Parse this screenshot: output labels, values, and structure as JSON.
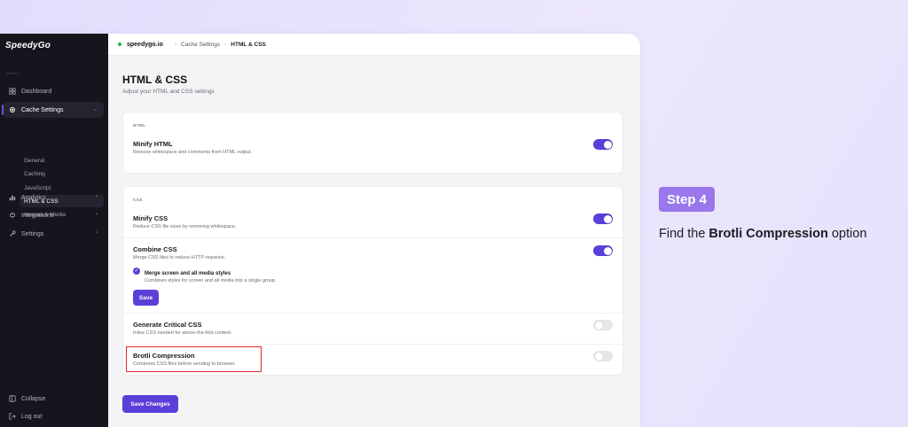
{
  "app": {
    "logo": "SpeedyGo"
  },
  "sidebar": {
    "menu_heading": "MENU",
    "items": [
      {
        "label": "Dashboard",
        "icon": "grid-icon"
      },
      {
        "label": "Cache Settings",
        "icon": "gear-icon",
        "active": true
      },
      {
        "label": "Analytics",
        "icon": "chart-icon"
      },
      {
        "label": "Integrations",
        "icon": "plug-icon"
      },
      {
        "label": "Settings",
        "icon": "wrench-icon"
      }
    ],
    "sub_items": [
      "General",
      "Caching",
      "JavaScript",
      "HTML & CSS",
      "Images & Media"
    ],
    "active_sub": "HTML & CSS",
    "footer": [
      {
        "label": "Collapse",
        "icon": "collapse-icon"
      },
      {
        "label": "Log out",
        "icon": "logout-icon"
      }
    ]
  },
  "topbar": {
    "site": "speedygo.io",
    "breadcrumb": [
      "Cache Settings",
      "HTML & CSS"
    ]
  },
  "page": {
    "title": "HTML & CSS",
    "subtitle": "Adjust your HTML and CSS settings"
  },
  "html_card": {
    "heading": "HTML",
    "minify_html": {
      "title": "Minify HTML",
      "desc": "Remove whitespace and comments from HTML output.",
      "enabled": true
    }
  },
  "css_card": {
    "heading": "CSS",
    "minify_css": {
      "title": "Minify CSS",
      "desc": "Reduce CSS file sizes by removing whitespace.",
      "enabled": true
    },
    "combine_css": {
      "title": "Combine CSS",
      "desc": "Merge CSS files to reduce HTTP requests.",
      "enabled": true,
      "option_title": "Merge screen and all media styles",
      "option_desc": "Combines styles for screen and all media into a single group.",
      "save_label": "Save"
    },
    "critical_css": {
      "title": "Generate Critical CSS",
      "desc": "Inline CSS needed for above-the-fold content.",
      "enabled": false
    },
    "brotli": {
      "title": "Brotli Compression",
      "desc": "Compress CSS files before sending to browser.",
      "enabled": false
    }
  },
  "actions": {
    "save_changes": "Save Changes"
  },
  "tutorial": {
    "step": "Step 4",
    "text_before": "Find the ",
    "text_bold": "Brotli Compression",
    "text_after": " option"
  },
  "colors": {
    "accent": "#5b3fd8",
    "sidebar_bg": "#16151d",
    "highlight": "#d62b2b",
    "step_badge": "#9a77ec"
  }
}
